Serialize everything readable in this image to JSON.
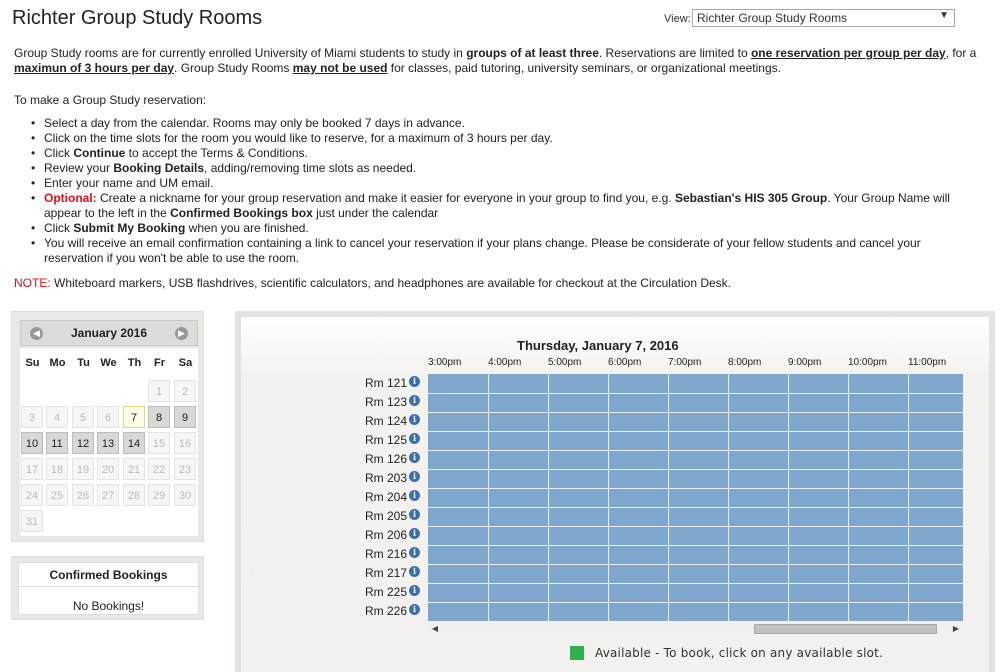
{
  "header": {
    "title": "Richter Group Study Rooms",
    "view_label": "View:",
    "view_selected": "Richter Group Study Rooms"
  },
  "intro": {
    "p1_a": "Group Study rooms are for currently enrolled University of Miami students to study in ",
    "p1_b": "groups of at least three",
    "p1_c": ".  Reservations are limited to ",
    "p1_d": "one reservation per group per day",
    "p1_e": ", for a ",
    "p1_f": "maximun of 3 hours per day",
    "p1_g": ".  Group Study Rooms ",
    "p1_h": "may not be used",
    "p1_i": " for classes, paid tutoring, university seminars, or organizational meetings.",
    "p2": "To make a Group Study reservation:"
  },
  "steps": {
    "s1": "Select a day from the calendar.  Rooms may only be booked 7 days in advance.",
    "s2": "Click on the time slots for the room you would like to reserve, for a maximum of 3 hours per day.",
    "s3_a": "Click ",
    "s3_b": "Continue",
    "s3_c": " to accept the Terms & Conditions.",
    "s4_a": "Review your ",
    "s4_b": "Booking Details",
    "s4_c": ", adding/removing time slots as needed.",
    "s5": "Enter your name and UM email.",
    "s6_a": "Optional:",
    "s6_b": "  Create a nickname for your group reservation and make it easier for everyone in your group to find you, e.g. ",
    "s6_c": "Sebastian's HIS 305 Group",
    "s6_d": ". Your Group Name will appear to the left in the ",
    "s6_e": "Confirmed Bookings box",
    "s6_f": " just under the calendar",
    "s7_a": "Click ",
    "s7_b": "Submit My Booking",
    "s7_c": " when you are finished.",
    "s8": "You will receive an email confirmation containing a link to cancel your reservation if your plans change.  Please be considerate of your fellow students and cancel your reservation if you won't be able to use the room."
  },
  "note": {
    "label": "NOTE:",
    "text": " Whiteboard markers, USB flashdrives, scientific calculators, and headphones are available for checkout at the Circulation Desk."
  },
  "calendar": {
    "month": "January 2016",
    "dow": [
      "Su",
      "Mo",
      "Tu",
      "We",
      "Th",
      "Fr",
      "Sa"
    ],
    "weeks": [
      [
        null,
        null,
        null,
        null,
        null,
        "1",
        "2"
      ],
      [
        "3",
        "4",
        "5",
        "6",
        "7",
        "8",
        "9"
      ],
      [
        "10",
        "11",
        "12",
        "13",
        "14",
        "15",
        "16"
      ],
      [
        "17",
        "18",
        "19",
        "20",
        "21",
        "22",
        "23"
      ],
      [
        "24",
        "25",
        "26",
        "27",
        "28",
        "29",
        "30"
      ],
      [
        "31",
        null,
        null,
        null,
        null,
        null,
        null
      ]
    ],
    "today": "7",
    "available": [
      "8",
      "9",
      "10",
      "11",
      "12",
      "13",
      "14"
    ]
  },
  "confirmed": {
    "title": "Confirmed Bookings",
    "empty": "No Bookings!"
  },
  "grid": {
    "date": "Thursday, January 7, 2016",
    "hours": [
      "3:00pm",
      "4:00pm",
      "5:00pm",
      "6:00pm",
      "7:00pm",
      "8:00pm",
      "9:00pm",
      "10:00pm",
      "11:00pm"
    ],
    "rooms": [
      "Rm 121",
      "Rm 123",
      "Rm 124",
      "Rm 125",
      "Rm 126",
      "Rm 203",
      "Rm 204",
      "Rm 205",
      "Rm 206",
      "Rm 216",
      "Rm 217",
      "Rm 225",
      "Rm 226"
    ],
    "info_icon": "i",
    "slot_color": "#7fa7cd",
    "legend_color": "#2db34a",
    "legend_text": "Available - To book, click on any available slot."
  }
}
